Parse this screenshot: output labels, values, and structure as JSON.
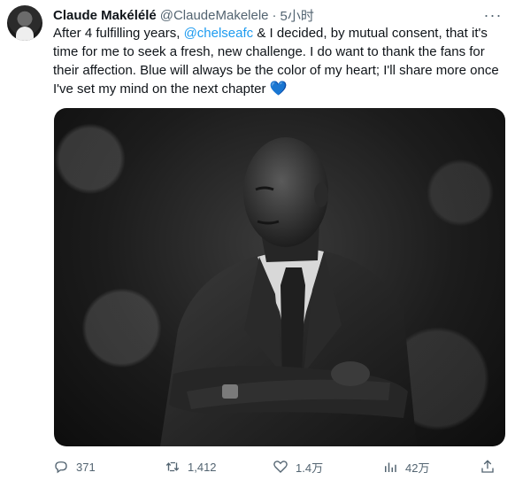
{
  "author": {
    "display_name": "Claude Makélélé",
    "handle": "@ClaudeMakelele",
    "separator": "·",
    "time": "5小时"
  },
  "tweet": {
    "text_part1": "After 4 fulfilling years, ",
    "mention": "@chelseafc",
    "text_part2": " & I decided, by mutual consent, that it's time for me to seek a fresh, new challenge. I do want to thank the fans for their affection. Blue will always be the color of my heart; I'll share more once I've set my mind on the next chapter ",
    "emoji": "💙"
  },
  "media": {
    "icon": "photo-of-man-in-suit"
  },
  "actions": {
    "reply_count": "371",
    "retweet_count": "1,412",
    "like_count": "1.4万",
    "view_count": "42万"
  },
  "colors": {
    "link": "#1d9bf0",
    "muted": "#536471",
    "text": "#0f1419"
  }
}
